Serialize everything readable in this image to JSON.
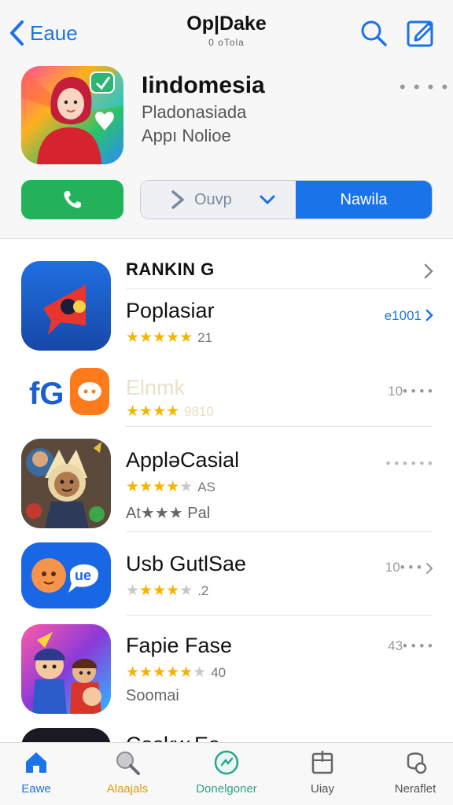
{
  "header": {
    "back_label": "Eaue",
    "title": "Op|Dake",
    "subtitle": "0 oTola"
  },
  "featured": {
    "name": "Iindomesia",
    "line1": "Pladonasiada",
    "line2": "Appı Nolioe",
    "more": "• • • •",
    "segment_left": "Ouvp",
    "segment_right": "Nawila"
  },
  "ranking": {
    "heading": "RANKIN G",
    "apps": [
      {
        "name": "Poplasiar",
        "rating": 5,
        "count": "21",
        "right": "e1001"
      },
      {
        "name": "Elnmk",
        "rating": 4,
        "count": "9810",
        "right": "10• • • •"
      },
      {
        "name": "AppləCasial",
        "rating": 4,
        "count": "AS",
        "meta": "At★★★ Pal",
        "right": "• • • • • •"
      },
      {
        "name": "Usb GutlSae",
        "rating": 4,
        "count": ".2",
        "right": "10• • •"
      },
      {
        "name": "Fapie Fase",
        "rating": 4,
        "count": "40",
        "meta": "Soomai",
        "right": "43• • • •"
      }
    ],
    "partial_name": "Caskw.Ea"
  },
  "tabs": [
    {
      "label": "Eawe",
      "color": "#1a73e8"
    },
    {
      "label": "Alaajals",
      "color": "#e39b0b"
    },
    {
      "label": "Donelgoner",
      "color": "#2aa58a"
    },
    {
      "label": "Uiay",
      "color": "#555555"
    },
    {
      "label": "Neraflet",
      "color": "#555555"
    }
  ],
  "colors": {
    "accent": "#1a73e8",
    "call_green": "#22b35a",
    "star": "#f4b400"
  },
  "icons": {
    "back": "chevron-left-icon",
    "search": "search-icon",
    "compose": "compose-icon",
    "call": "phone-icon",
    "home": "home-icon",
    "apps": "apps-icon",
    "games": "games-icon",
    "library": "library-icon",
    "profile": "profile-icon"
  }
}
